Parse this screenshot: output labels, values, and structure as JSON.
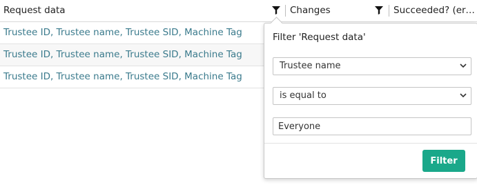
{
  "grid": {
    "columns": [
      {
        "label": "Request data"
      },
      {
        "label": "Changes"
      },
      {
        "label": "Succeeded? (err..."
      }
    ],
    "rows": [
      {
        "request_data": "Trustee ID, Trustee name, Trustee SID, Machine Tag"
      },
      {
        "request_data": "Trustee ID, Trustee name, Trustee SID, Machine Tag"
      },
      {
        "request_data": "Trustee ID, Trustee name, Trustee SID, Machine Tag"
      }
    ]
  },
  "filter_popup": {
    "title": "Filter 'Request data'",
    "column_select": "Trustee name",
    "operator_select": "is equal to",
    "value_input": "Everyone",
    "filter_button": "Filter"
  },
  "colors": {
    "link_text": "#3a7a8c",
    "filter_button": "#1aa88a"
  }
}
